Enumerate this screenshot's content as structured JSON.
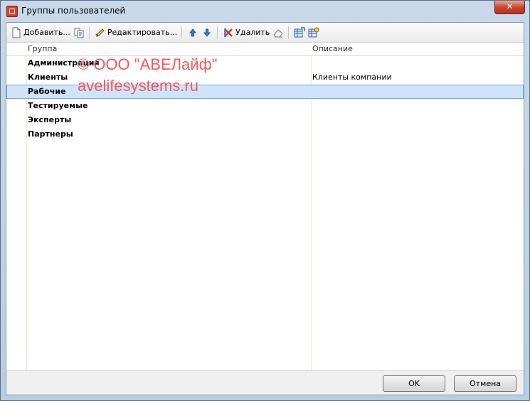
{
  "window": {
    "title": "Группы пользователей",
    "close_label": "✕"
  },
  "toolbar": {
    "add_label": "Добавить...",
    "edit_label": "Редактировать...",
    "delete_label": "Удалить"
  },
  "grid": {
    "columns": [
      "Группа",
      "Описание"
    ],
    "rows": [
      {
        "name": "Администрация",
        "description": ""
      },
      {
        "name": "Клиенты",
        "description": "Клиенты компании"
      },
      {
        "name": "Рабочие",
        "description": ""
      },
      {
        "name": "Тестируемые",
        "description": ""
      },
      {
        "name": "Эксперты",
        "description": ""
      },
      {
        "name": "Партнеры",
        "description": ""
      }
    ],
    "selected_row": 2
  },
  "watermark": {
    "line1": "© ООО \"АВЕЛайф\"",
    "line2": "avelifesystems.ru"
  },
  "footer": {
    "ok_label": "OK",
    "cancel_label": "Отмена"
  }
}
